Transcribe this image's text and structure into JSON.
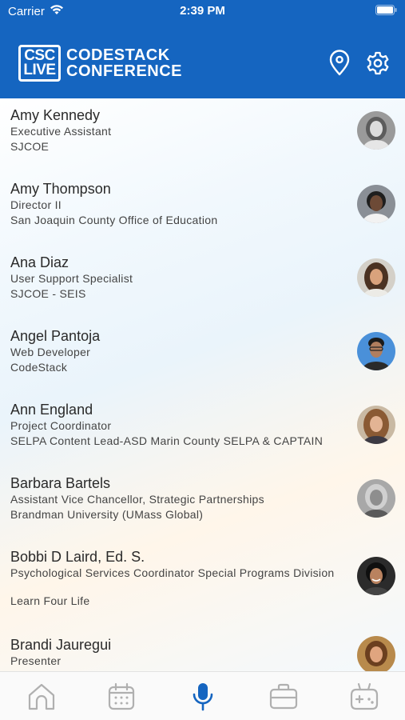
{
  "status": {
    "carrier": "Carrier",
    "time": "2:39 PM"
  },
  "logo": {
    "badge_top": "CSC",
    "badge_bottom": "LIVE",
    "line1": "CODESTACK",
    "line2": "CONFERENCE"
  },
  "header_icons": [
    "location-pin-icon",
    "gear-icon"
  ],
  "people": [
    {
      "name": "Amy Kennedy",
      "title": "Executive Assistant",
      "org": "SJCOE"
    },
    {
      "name": "Amy Thompson",
      "title": "Director II",
      "org": "San Joaquin County Office of Education"
    },
    {
      "name": "Ana Diaz",
      "title": "User Support Specialist",
      "org": "SJCOE - SEIS"
    },
    {
      "name": "Angel Pantoja",
      "title": "Web Developer",
      "org": "CodeStack"
    },
    {
      "name": "Ann England",
      "title": "Project Coordinator",
      "org": "SELPA Content Lead-ASD Marin County SELPA & CAPTAIN"
    },
    {
      "name": "Barbara Bartels",
      "title": "Assistant Vice Chancellor, Strategic Partnerships",
      "org": "Brandman University (UMass Global)"
    },
    {
      "name": "Bobbi D Laird, Ed. S.",
      "title": "Psychological Services Coordinator Special Programs Division",
      "org": "Learn Four Life"
    },
    {
      "name": "Brandi Jauregui",
      "title": "Presenter",
      "org": ""
    }
  ],
  "tabs": [
    {
      "icon": "home-icon",
      "active": false
    },
    {
      "icon": "calendar-icon",
      "active": false
    },
    {
      "icon": "microphone-icon",
      "active": true
    },
    {
      "icon": "briefcase-icon",
      "active": false
    },
    {
      "icon": "gamepad-icon",
      "active": false
    }
  ],
  "colors": {
    "brand": "#1565c0",
    "tab_inactive": "#b0b0b0",
    "tab_active": "#1565c0"
  }
}
